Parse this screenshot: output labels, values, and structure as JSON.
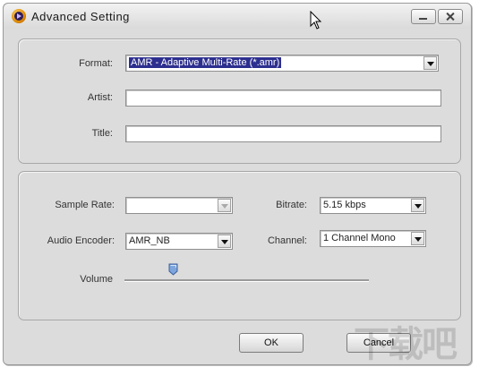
{
  "window": {
    "title": "Advanced  Setting"
  },
  "general": {
    "format_label": "Format:",
    "format_value": "AMR - Adaptive Multi-Rate (*.amr)",
    "artist_label": "Artist:",
    "artist_value": "",
    "title_label": "Title:",
    "title_value": ""
  },
  "audio": {
    "sample_rate_label": "Sample Rate:",
    "sample_rate_value": "",
    "bitrate_label": "Bitrate:",
    "bitrate_value": "5.15 kbps",
    "encoder_label": "Audio Encoder:",
    "encoder_value": "AMR_NB",
    "channel_label": "Channel:",
    "channel_value": "1 Channel Mono",
    "volume_label": "Volume",
    "volume_level": 0.2
  },
  "buttons": {
    "ok_label": "OK",
    "cancel_label": "Cancel"
  },
  "watermark": "下载吧",
  "colors": {
    "selection": "#2d2f8f",
    "window_bg": "#dcdcdc"
  }
}
